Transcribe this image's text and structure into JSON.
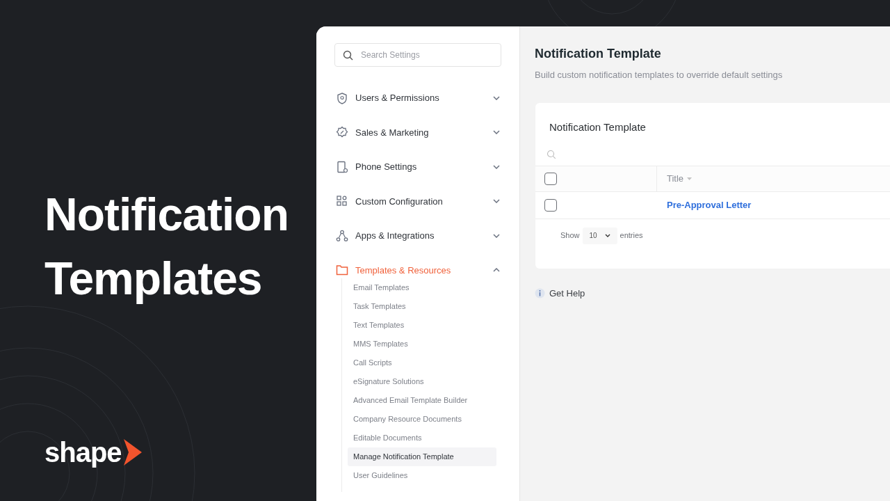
{
  "promo": {
    "headline": [
      "Notification",
      "Templates"
    ],
    "logo": "shape"
  },
  "sidebar": {
    "search": {
      "placeholder": "Search Settings"
    },
    "sections": [
      {
        "label": "Users & Permissions",
        "active": false,
        "expanded": false
      },
      {
        "label": "Sales & Marketing",
        "active": false,
        "expanded": false
      },
      {
        "label": "Phone Settings",
        "active": false,
        "expanded": false
      },
      {
        "label": "Custom Configuration",
        "active": false,
        "expanded": false
      },
      {
        "label": "Apps & Integrations",
        "active": false,
        "expanded": false
      },
      {
        "label": "Templates & Resources",
        "active": true,
        "expanded": true,
        "children": [
          {
            "label": "Email Templates",
            "selected": false
          },
          {
            "label": "Task Templates",
            "selected": false
          },
          {
            "label": "Text Templates",
            "selected": false
          },
          {
            "label": "MMS Templates",
            "selected": false
          },
          {
            "label": "Call Scripts",
            "selected": false
          },
          {
            "label": "eSignature Solutions",
            "selected": false
          },
          {
            "label": "Advanced Email Template Builder",
            "selected": false
          },
          {
            "label": "Company Resource Documents",
            "selected": false
          },
          {
            "label": "Editable Documents",
            "selected": false
          },
          {
            "label": "Manage Notification Template",
            "selected": true
          },
          {
            "label": "User Guidelines",
            "selected": false
          }
        ]
      }
    ]
  },
  "main": {
    "title": "Notification Template",
    "subtitle": "Build custom notification templates to override default settings",
    "card": {
      "title": "Notification Template",
      "columns": [
        {
          "label": "Title",
          "sortable": true
        }
      ],
      "header_checked": false,
      "rows": [
        {
          "title": "Pre-Approval Letter",
          "checked": false
        }
      ],
      "show_label": "Show",
      "page_size": "10",
      "entries_label": "entries"
    },
    "help": "Get Help"
  }
}
